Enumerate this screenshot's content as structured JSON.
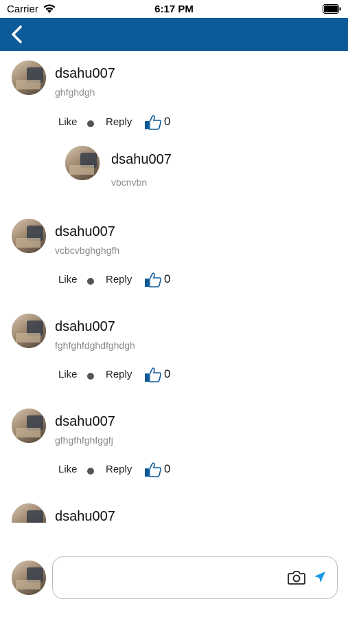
{
  "status_bar": {
    "carrier": "Carrier",
    "time": "6:17 PM"
  },
  "nav_bar": {
    "back_icon": "chevron-left-icon",
    "color": "#0d5a99"
  },
  "comments": [
    {
      "username": "dsahu007",
      "text": "ghfghdgh",
      "like_label": "Like",
      "reply_label": "Reply",
      "likes": "0",
      "replies": [
        {
          "username": "dsahu007",
          "text": "vbcnvbn"
        }
      ]
    },
    {
      "username": "dsahu007",
      "text": "vcbcvbghghgfh",
      "like_label": "Like",
      "reply_label": "Reply",
      "likes": "0"
    },
    {
      "username": "dsahu007",
      "text": "fghfghfdghdfghdgh",
      "like_label": "Like",
      "reply_label": "Reply",
      "likes": "0"
    },
    {
      "username": "dsahu007",
      "text": "gfhgfhfghfggfj",
      "like_label": "Like",
      "reply_label": "Reply",
      "likes": "0"
    },
    {
      "username": "dsahu007"
    }
  ],
  "composer": {
    "placeholder": "",
    "value": "",
    "camera_icon": "camera-icon",
    "send_icon": "send-icon",
    "accent": "#1a9be0"
  }
}
